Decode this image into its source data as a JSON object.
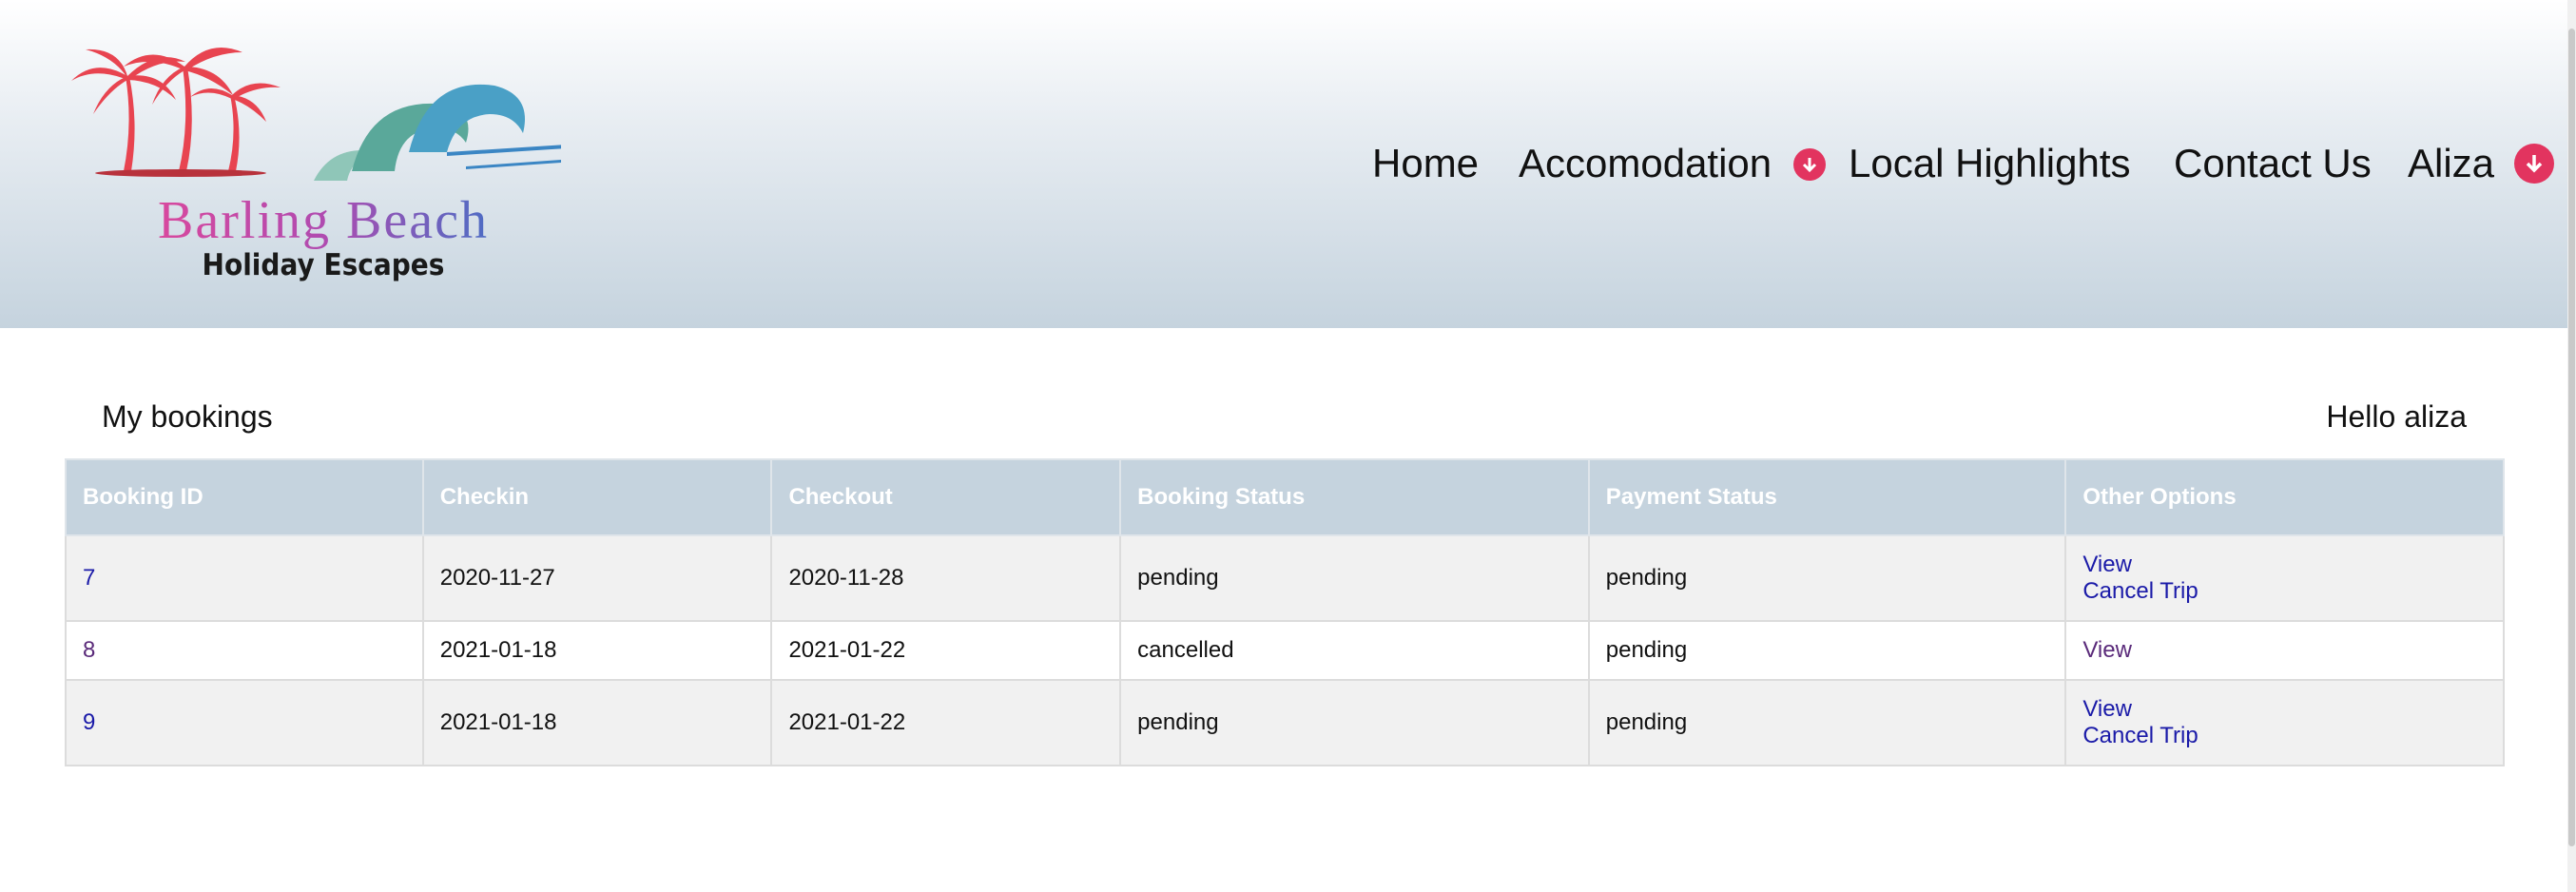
{
  "logo": {
    "title": "Barling Beach",
    "subtitle": "Holiday Escapes"
  },
  "nav": {
    "home": "Home",
    "accommodation": "Accomodation",
    "local_highlights": "Local Highlights",
    "contact_us": "Contact Us",
    "user": "Aliza"
  },
  "page": {
    "title": "My bookings",
    "greeting": "Hello aliza"
  },
  "table": {
    "headers": [
      "Booking ID",
      "Checkin",
      "Checkout",
      "Booking Status",
      "Payment Status",
      "Other Options"
    ],
    "rows": [
      {
        "id": "7",
        "checkin": "2020-11-27",
        "checkout": "2020-11-28",
        "booking_status": "pending",
        "payment_status": "pending",
        "view": "View",
        "cancel": "Cancel Trip"
      },
      {
        "id": "8",
        "checkin": "2021-01-18",
        "checkout": "2021-01-22",
        "booking_status": "cancelled",
        "payment_status": "pending",
        "view": "View"
      },
      {
        "id": "9",
        "checkin": "2021-01-18",
        "checkout": "2021-01-22",
        "booking_status": "pending",
        "payment_status": "pending",
        "view": "View",
        "cancel": "Cancel Trip"
      }
    ]
  },
  "colors": {
    "accent": "#e2345f",
    "header_bg": "#c5d3de",
    "link": "#1a1aa8",
    "visited_link": "#5a2a7a"
  }
}
